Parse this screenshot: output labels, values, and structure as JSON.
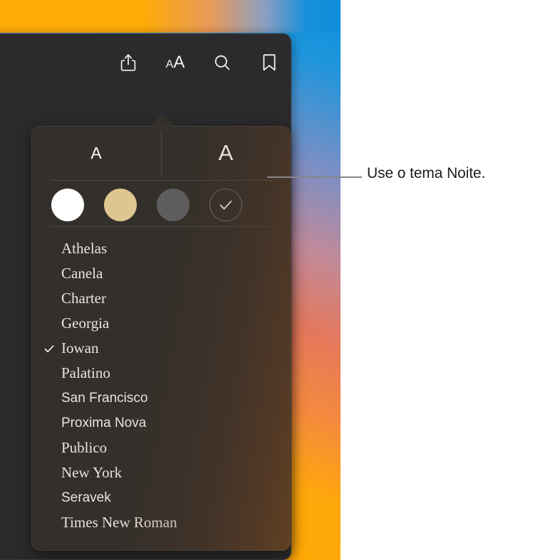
{
  "desktop": {
    "wallpaper_gradient_colors": [
      "#0d93dd",
      "#c08a9a",
      "#e4785c",
      "#ffab00"
    ]
  },
  "window": {
    "background_color": "#2b2b2d",
    "toolbar": {
      "buttons": [
        {
          "name": "share-icon",
          "label": "Partilhar"
        },
        {
          "name": "text-size-icon",
          "label": "AA",
          "small_a": "A",
          "large_a": "A"
        },
        {
          "name": "search-icon",
          "label": "Pesquisar"
        },
        {
          "name": "bookmark-icon",
          "label": "Marcador"
        }
      ]
    }
  },
  "popover": {
    "background_color": "#332f2b",
    "font_size_controls": {
      "decrease_label": "A",
      "increase_label": "A"
    },
    "themes": {
      "selected_index": 3,
      "items": [
        {
          "name": "theme-white",
          "label": "Branco",
          "color": "#ffffff",
          "selected": false
        },
        {
          "name": "theme-sepia",
          "label": "Sépia",
          "color": "#ddc68f",
          "selected": false
        },
        {
          "name": "theme-gray",
          "label": "Cinzento",
          "color": "#5e5e60",
          "selected": false
        },
        {
          "name": "theme-night",
          "label": "Noite",
          "color": "#332f2c",
          "selected": true
        }
      ]
    },
    "fonts": {
      "selected": "Iowan",
      "items": [
        {
          "label": "Athelas",
          "style": "serif",
          "selected": false
        },
        {
          "label": "Canela",
          "style": "serif",
          "selected": false
        },
        {
          "label": "Charter",
          "style": "serif",
          "selected": false
        },
        {
          "label": "Georgia",
          "style": "serif",
          "selected": false
        },
        {
          "label": "Iowan",
          "style": "serif",
          "selected": true
        },
        {
          "label": "Palatino",
          "style": "serif",
          "selected": false
        },
        {
          "label": "San Francisco",
          "style": "sans",
          "selected": false
        },
        {
          "label": "Proxima Nova",
          "style": "sans",
          "selected": false
        },
        {
          "label": "Publico",
          "style": "serif",
          "selected": false
        },
        {
          "label": "New York",
          "style": "serif",
          "selected": false
        },
        {
          "label": "Seravek",
          "style": "sans",
          "selected": false
        },
        {
          "label": "Times New Roman",
          "style": "serif",
          "selected": false
        }
      ]
    }
  },
  "callout": {
    "text": "Use o tema Noite.",
    "line_color": "#86868b",
    "text_color": "#1d1d1f"
  }
}
